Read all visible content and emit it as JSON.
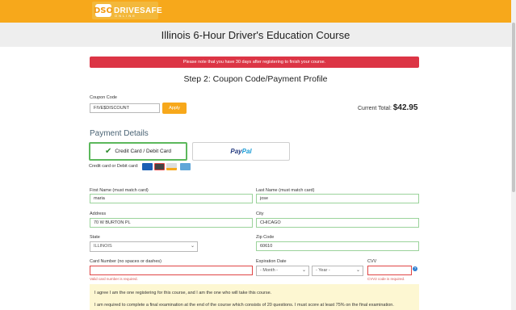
{
  "brand": {
    "logo_badge": "DSO",
    "logo_text": "DRIVESAFE",
    "logo_sub": "ONLINE"
  },
  "course_title": "Illinois 6-Hour Driver's Education Course",
  "alert": "Please note that you have 30 days after registering to finish your course.",
  "step_title": "Step 2: Coupon Code/Payment Profile",
  "coupon": {
    "label": "Coupon Code",
    "value": "FIVE$DISCOUNT",
    "apply_label": "Apply"
  },
  "total": {
    "label": "Current Total:",
    "amount": "$42.95"
  },
  "payment": {
    "title": "Payment Details",
    "credit_label": "Credit Card / Debit Card",
    "paypal_a": "Pay",
    "paypal_b": "Pal",
    "cards_caption": "Credit card or Debit card:",
    "card_icons": [
      "visa-icon",
      "mastercard-icon",
      "discover-icon",
      "amex-icon"
    ]
  },
  "form": {
    "first_name": {
      "label": "First Name (must match card)",
      "value": "maria"
    },
    "last_name": {
      "label": "Last Name (must match card)",
      "value": "jose"
    },
    "address": {
      "label": "Address",
      "value": "70 W BURTON PL"
    },
    "city": {
      "label": "City",
      "value": "CHICAGO"
    },
    "state": {
      "label": "State",
      "value": "ILLINOIS"
    },
    "zip": {
      "label": "Zip Code",
      "value": "60610"
    },
    "card_number": {
      "label": "Card Number (no spaces or dashes)",
      "value": "",
      "error": "Valid card number is required."
    },
    "expiration": {
      "label": "Expiration Date",
      "month": "- Month -",
      "year": "- Year -"
    },
    "cvv": {
      "label": "CVV",
      "value": "",
      "error": "CVV2 code is required."
    }
  },
  "agreement": {
    "line1": "I agree I am the one registering for this course, and I am the one who will take this course.",
    "line2": "I am required to complete a final examination at the end of the course which consists of 20 questions. I must score at least 75% on the final examination."
  },
  "colors": {
    "brand_orange": "#f7a81b",
    "alert_red": "#dc3545",
    "valid_green": "#5cb85c",
    "error_red": "#d9534f"
  }
}
